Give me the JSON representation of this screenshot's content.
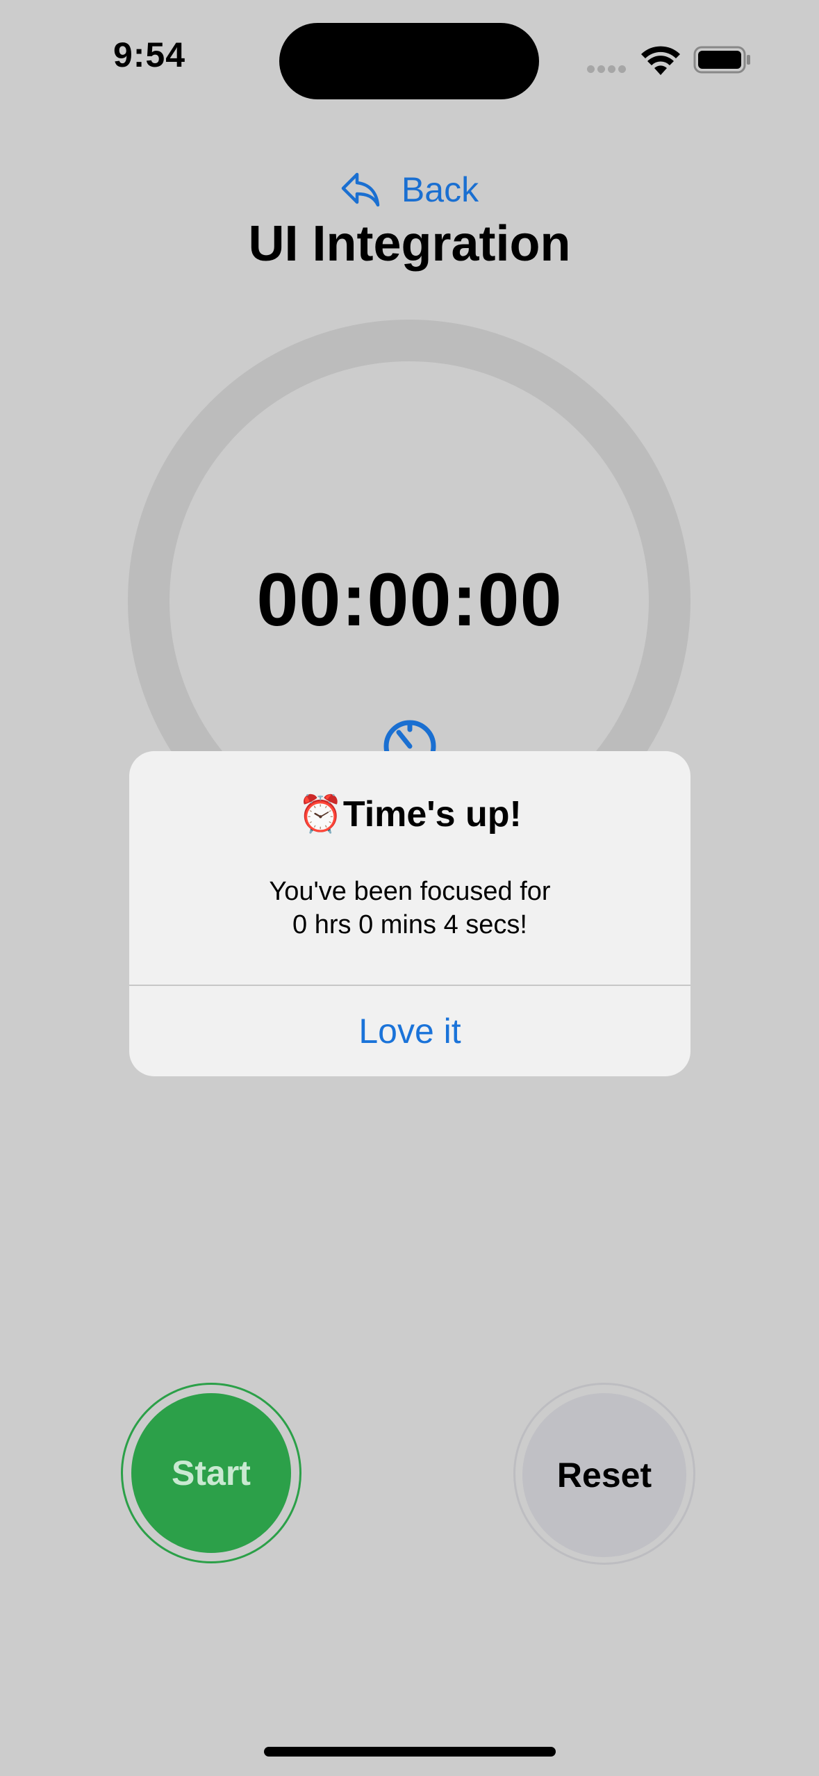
{
  "status_bar": {
    "time": "9:54"
  },
  "nav": {
    "back_label": "Back",
    "title": "UI Integration"
  },
  "timer": {
    "display": "00:00:00"
  },
  "alert": {
    "title": "⏰Time's up!",
    "message_line1": "You've been focused for",
    "message_line2": "0 hrs 0 mins 4 secs!",
    "button_label": "Love it"
  },
  "controls": {
    "start_label": "Start",
    "reset_label": "Reset"
  },
  "colors": {
    "background": "#cccccc",
    "accent_blue": "#1a6fd1",
    "start_green": "#2ca049",
    "reset_gray": "#c0c0c5",
    "ring_gray": "#bcbcbc"
  }
}
